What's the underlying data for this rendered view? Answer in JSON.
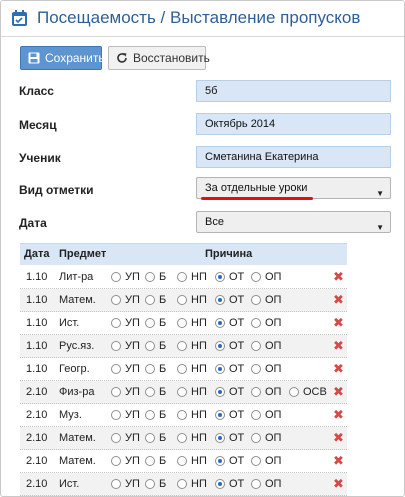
{
  "header": {
    "title": "Посещаемость / Выставление пропусков"
  },
  "toolbar": {
    "save_label": "Сохранить",
    "restore_label": "Восстановить"
  },
  "form": {
    "class_label": "Класс",
    "class_value": "5б",
    "month_label": "Месяц",
    "month_value": "Октябрь 2014",
    "student_label": "Ученик",
    "student_value": "Сметанина Екатерина",
    "mark_type_label": "Вид отметки",
    "mark_type_value": "За отдельные уроки",
    "date_label": "Дата",
    "date_value": "Все"
  },
  "table": {
    "headers": {
      "date": "Дата",
      "subject": "Предмет",
      "reason": "Причина"
    },
    "reason_options": [
      "УП",
      "Б",
      "НП",
      "ОТ",
      "ОП"
    ],
    "extra_option": "ОСВ",
    "rows": [
      {
        "date": "1.10",
        "subject": "Лит-ра",
        "selected": "ОТ",
        "has_extra": false
      },
      {
        "date": "1.10",
        "subject": "Матем.",
        "selected": "ОТ",
        "has_extra": false
      },
      {
        "date": "1.10",
        "subject": "Ист.",
        "selected": "ОТ",
        "has_extra": false
      },
      {
        "date": "1.10",
        "subject": "Рус.яз.",
        "selected": "ОТ",
        "has_extra": false
      },
      {
        "date": "1.10",
        "subject": "Геогр.",
        "selected": "ОТ",
        "has_extra": false
      },
      {
        "date": "2.10",
        "subject": "Физ-ра",
        "selected": "ОТ",
        "has_extra": true
      },
      {
        "date": "2.10",
        "subject": "Муз.",
        "selected": "ОТ",
        "has_extra": false
      },
      {
        "date": "2.10",
        "subject": "Матем.",
        "selected": "ОТ",
        "has_extra": false
      },
      {
        "date": "2.10",
        "subject": "Матем.",
        "selected": "ОТ",
        "has_extra": false
      },
      {
        "date": "2.10",
        "subject": "Ист.",
        "selected": "ОТ",
        "has_extra": false
      }
    ]
  },
  "colors": {
    "title": "#2f5f96",
    "save_button": "#5e95d1",
    "field_blue": "#d8e6f5",
    "delete": "#d24a4a",
    "underline": "#e01010"
  },
  "icons": {
    "header": "attendance-icon",
    "save": "floppy-disk-icon",
    "restore": "refresh-icon",
    "delete": "close-x-icon"
  }
}
